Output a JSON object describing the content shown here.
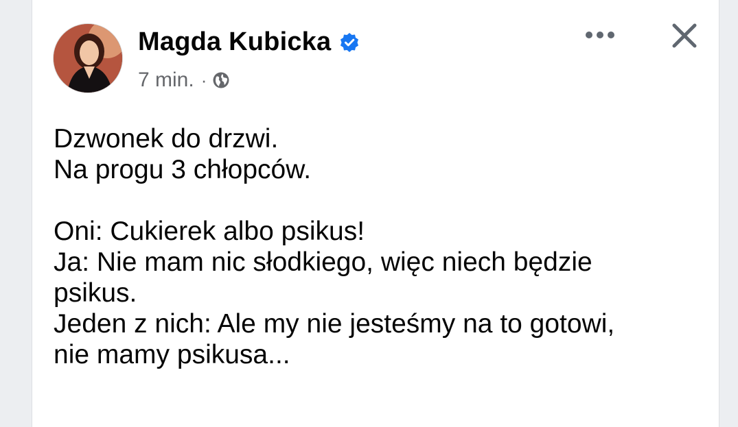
{
  "post": {
    "author": "Magda Kubicka",
    "verified_icon": "verified-badge-icon",
    "time": "7 min.",
    "separator": "·",
    "privacy_icon": "globe-icon",
    "more_icon": "more-options-icon",
    "close_icon": "close-icon",
    "lines": [
      "Dzwonek do drzwi.",
      "Na progu 3 chłopców.",
      "",
      "Oni: Cukierek albo psikus!",
      "Ja: Nie mam nic słodkiego, więc niech będzie",
      "psikus.",
      "Jeden z nich: Ale my nie jesteśmy na to gotowi,",
      "nie mamy psikusa..."
    ]
  },
  "colors": {
    "text": "#050505",
    "meta": "#65676b",
    "verified": "#1877f2",
    "icon": "#606770"
  }
}
